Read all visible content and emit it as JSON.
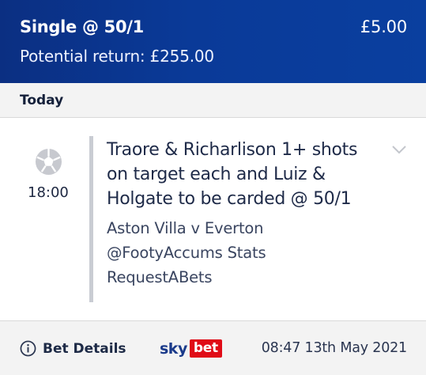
{
  "header": {
    "bet_type": "Single @ 50/1",
    "stake": "£5.00",
    "potential_return": "Potential return: £255.00"
  },
  "date_group": {
    "label": "Today"
  },
  "event": {
    "sport_icon": "football-icon",
    "time": "18:00",
    "selection": "Traore & Richarlison 1+ shots on target each and Luiz & Holgate to be carded @ 50/1",
    "match": "Aston Villa v Everton",
    "tag": "@FootyAccums Stats",
    "tag2": "RequestABets"
  },
  "footer": {
    "details_label": "Bet Details",
    "info_icon": "info-icon",
    "logo_sky": "sky",
    "logo_bet": "bet",
    "placed": "08:47 13th May 2021"
  },
  "colors": {
    "header_bg": "#0a3a98",
    "brand_red": "#e00b17",
    "brand_blue": "#1a3a8a"
  }
}
